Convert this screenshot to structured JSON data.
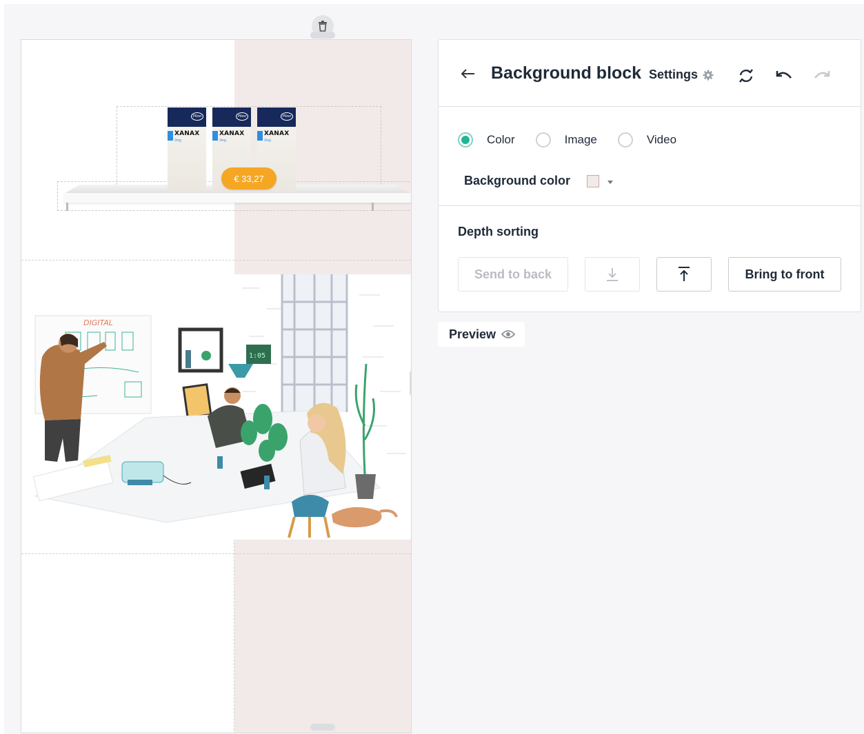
{
  "canvas": {
    "price_label": "€ 33,27",
    "product_name": "XANAX",
    "product_dose": "2mg",
    "brand_logo": "Pfizer",
    "whiteboard_heading": "DIGITAL",
    "clock_text": "1:05"
  },
  "panel": {
    "title": "Background block",
    "settings_label": "Settings",
    "background_type_options": [
      {
        "label": "Color",
        "checked": true
      },
      {
        "label": "Image",
        "checked": false
      },
      {
        "label": "Video",
        "checked": false
      }
    ],
    "background_color_label": "Background color",
    "background_color_value": "#f2eae8",
    "depth_sorting_title": "Depth sorting",
    "send_to_back_label": "Send to back",
    "bring_to_front_label": "Bring to front"
  },
  "preview_label": "Preview",
  "colors": {
    "accent": "#1fb596",
    "price_tag": "#f5a623",
    "text": "#1f2a37",
    "canvas_tint": "#f2eae8"
  },
  "icons": [
    "trash-icon",
    "back-arrow-icon",
    "gear-icon",
    "sync-icon",
    "undo-icon",
    "redo-icon",
    "arrow-down-to-line-icon",
    "arrow-up-to-line-icon",
    "eye-icon"
  ]
}
